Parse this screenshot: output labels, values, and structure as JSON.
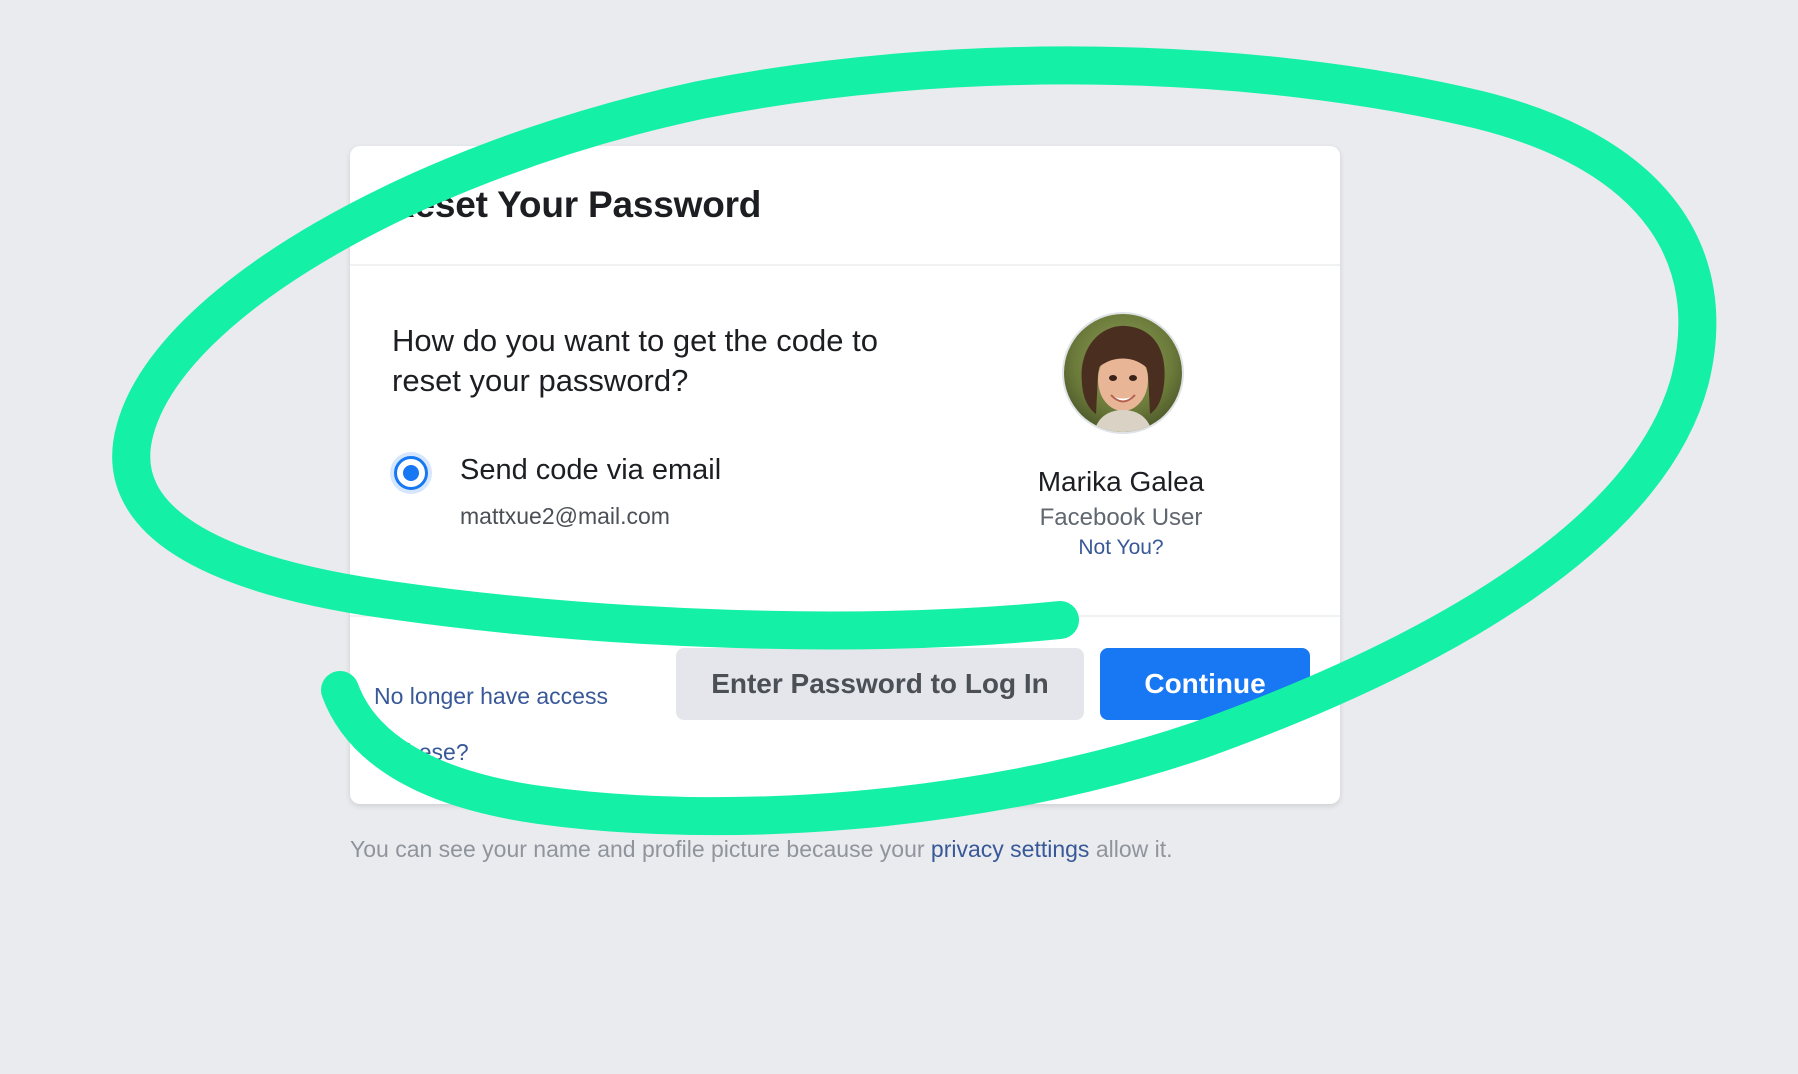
{
  "dialog": {
    "title": "Reset Your Password",
    "question": "How do you want to get the code to reset your password?",
    "option": {
      "label": "Send code via email",
      "email": "mattxue2@mail.com",
      "selected": true
    }
  },
  "user": {
    "name": "Marika Galea",
    "subtitle": "Facebook User",
    "not_you_link": "Not You?"
  },
  "footer": {
    "no_access_link": "No longer have access to these?",
    "enter_password_button": "Enter Password to Log In",
    "continue_button": "Continue"
  },
  "privacy": {
    "text_before": "You can see your name and profile picture because your ",
    "link": "privacy settings",
    "text_after": " allow it."
  },
  "colors": {
    "page_background": "#e9ebee",
    "primary_blue": "#1877f2",
    "link_blue": "#385898",
    "annotation_green": "#14f0a5"
  },
  "icons": {
    "avatar": "profile-photo",
    "radio": "radio-selected-icon"
  }
}
